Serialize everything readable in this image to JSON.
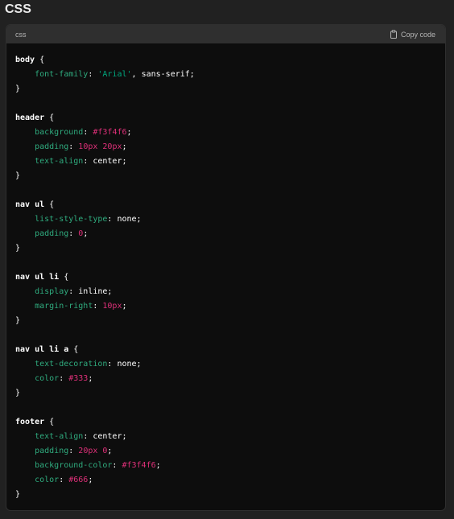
{
  "heading": "CSS",
  "code_block": {
    "language": "css",
    "copy_label": "Copy code",
    "copy_icon": "clipboard-icon",
    "colors": {
      "background": "#0d0d0d",
      "header_background": "#2f2f2f",
      "property": "#2fab7e",
      "string": "#00a67d",
      "number": "#df3079",
      "plain": "#ffffff"
    },
    "lines": [
      [
        {
          "t": "sel",
          "v": "body"
        },
        {
          "t": "punct",
          "v": " {"
        }
      ],
      [
        {
          "t": "punct",
          "v": "    "
        },
        {
          "t": "prop",
          "v": "font-family"
        },
        {
          "t": "punct",
          "v": ": "
        },
        {
          "t": "str",
          "v": "'Arial'"
        },
        {
          "t": "punct",
          "v": ", sans-serif;"
        }
      ],
      [
        {
          "t": "punct",
          "v": "}"
        }
      ],
      [],
      [
        {
          "t": "sel",
          "v": "header"
        },
        {
          "t": "punct",
          "v": " {"
        }
      ],
      [
        {
          "t": "punct",
          "v": "    "
        },
        {
          "t": "prop",
          "v": "background"
        },
        {
          "t": "punct",
          "v": ": "
        },
        {
          "t": "num",
          "v": "#f3f4f6"
        },
        {
          "t": "punct",
          "v": ";"
        }
      ],
      [
        {
          "t": "punct",
          "v": "    "
        },
        {
          "t": "prop",
          "v": "padding"
        },
        {
          "t": "punct",
          "v": ": "
        },
        {
          "t": "num",
          "v": "10px 20px"
        },
        {
          "t": "punct",
          "v": ";"
        }
      ],
      [
        {
          "t": "punct",
          "v": "    "
        },
        {
          "t": "prop",
          "v": "text-align"
        },
        {
          "t": "punct",
          "v": ": center;"
        }
      ],
      [
        {
          "t": "punct",
          "v": "}"
        }
      ],
      [],
      [
        {
          "t": "sel",
          "v": "nav ul"
        },
        {
          "t": "punct",
          "v": " {"
        }
      ],
      [
        {
          "t": "punct",
          "v": "    "
        },
        {
          "t": "prop",
          "v": "list-style-type"
        },
        {
          "t": "punct",
          "v": ": none;"
        }
      ],
      [
        {
          "t": "punct",
          "v": "    "
        },
        {
          "t": "prop",
          "v": "padding"
        },
        {
          "t": "punct",
          "v": ": "
        },
        {
          "t": "num",
          "v": "0"
        },
        {
          "t": "punct",
          "v": ";"
        }
      ],
      [
        {
          "t": "punct",
          "v": "}"
        }
      ],
      [],
      [
        {
          "t": "sel",
          "v": "nav ul li"
        },
        {
          "t": "punct",
          "v": " {"
        }
      ],
      [
        {
          "t": "punct",
          "v": "    "
        },
        {
          "t": "prop",
          "v": "display"
        },
        {
          "t": "punct",
          "v": ": inline;"
        }
      ],
      [
        {
          "t": "punct",
          "v": "    "
        },
        {
          "t": "prop",
          "v": "margin-right"
        },
        {
          "t": "punct",
          "v": ": "
        },
        {
          "t": "num",
          "v": "10px"
        },
        {
          "t": "punct",
          "v": ";"
        }
      ],
      [
        {
          "t": "punct",
          "v": "}"
        }
      ],
      [],
      [
        {
          "t": "sel",
          "v": "nav ul li a"
        },
        {
          "t": "punct",
          "v": " {"
        }
      ],
      [
        {
          "t": "punct",
          "v": "    "
        },
        {
          "t": "prop",
          "v": "text-decoration"
        },
        {
          "t": "punct",
          "v": ": none;"
        }
      ],
      [
        {
          "t": "punct",
          "v": "    "
        },
        {
          "t": "prop",
          "v": "color"
        },
        {
          "t": "punct",
          "v": ": "
        },
        {
          "t": "num",
          "v": "#333"
        },
        {
          "t": "punct",
          "v": ";"
        }
      ],
      [
        {
          "t": "punct",
          "v": "}"
        }
      ],
      [],
      [
        {
          "t": "sel",
          "v": "footer"
        },
        {
          "t": "punct",
          "v": " {"
        }
      ],
      [
        {
          "t": "punct",
          "v": "    "
        },
        {
          "t": "prop",
          "v": "text-align"
        },
        {
          "t": "punct",
          "v": ": center;"
        }
      ],
      [
        {
          "t": "punct",
          "v": "    "
        },
        {
          "t": "prop",
          "v": "padding"
        },
        {
          "t": "punct",
          "v": ": "
        },
        {
          "t": "num",
          "v": "20px 0"
        },
        {
          "t": "punct",
          "v": ";"
        }
      ],
      [
        {
          "t": "punct",
          "v": "    "
        },
        {
          "t": "prop",
          "v": "background-color"
        },
        {
          "t": "punct",
          "v": ": "
        },
        {
          "t": "num",
          "v": "#f3f4f6"
        },
        {
          "t": "punct",
          "v": ";"
        }
      ],
      [
        {
          "t": "punct",
          "v": "    "
        },
        {
          "t": "prop",
          "v": "color"
        },
        {
          "t": "punct",
          "v": ": "
        },
        {
          "t": "num",
          "v": "#666"
        },
        {
          "t": "punct",
          "v": ";"
        }
      ],
      [
        {
          "t": "punct",
          "v": "}"
        }
      ]
    ]
  }
}
